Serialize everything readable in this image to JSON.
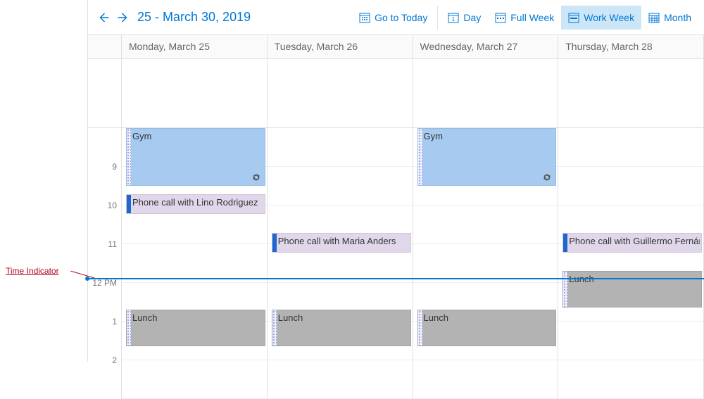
{
  "annotation": {
    "label": "Time Indicator"
  },
  "toolbar": {
    "date_range": "25 - March 30, 2019",
    "go_today": "Go to Today",
    "views": {
      "day": "Day",
      "full_week": "Full Week",
      "work_week": "Work Week",
      "month": "Month"
    },
    "active_view": "work_week"
  },
  "day_headers": [
    "Monday, March 25",
    "Tuesday, March 26",
    "Wednesday, March 27",
    "Thursday, March 28"
  ],
  "hours": [
    "9",
    "10",
    "11",
    "12 PM",
    "1",
    "2"
  ],
  "now_row_index": 3,
  "events": {
    "monday": {
      "gym": {
        "title": "Gym",
        "recurring": true
      },
      "phone_lino": {
        "title": "Phone call with Lino Rodriguez"
      },
      "lunch": {
        "title": "Lunch"
      }
    },
    "tuesday": {
      "phone_maria": {
        "title": "Phone call with Maria Anders"
      },
      "lunch": {
        "title": "Lunch"
      }
    },
    "wednesday": {
      "gym": {
        "title": "Gym",
        "recurring": true
      },
      "lunch": {
        "title": "Lunch"
      }
    },
    "thursday": {
      "phone_guillermo": {
        "title": "Phone call with Guillermo Fernández"
      },
      "lunch": {
        "title": "Lunch"
      }
    }
  },
  "colors": {
    "accent": "#0078d4",
    "gym": "#a6caf0",
    "phone": "#e0d8ea",
    "lunch": "#b3b3b3"
  }
}
